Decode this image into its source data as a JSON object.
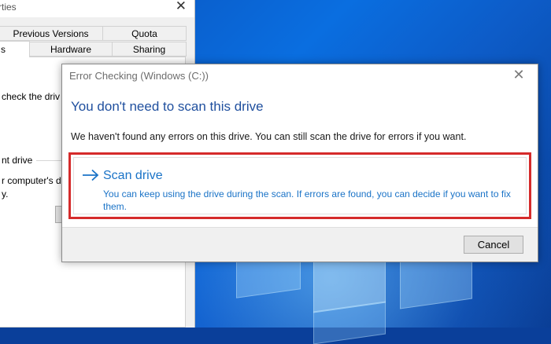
{
  "properties_window": {
    "title_fragment": "rties",
    "close_glyph": "✕",
    "tabs": [
      {
        "label": "Previous Versions"
      },
      {
        "label": "Quota"
      },
      {
        "label": "s"
      },
      {
        "label": "Hardware"
      },
      {
        "label": "Sharing"
      }
    ],
    "text_fragments": [
      "check the driv",
      "nt drive",
      "r computer's dr",
      "y."
    ]
  },
  "dialog": {
    "title": "Error Checking (Windows (C:))",
    "close_glyph": "✕",
    "heading": "You don't need to scan this drive",
    "message": "We haven't found any errors on this drive. You can still scan the drive for errors if you want.",
    "scan_option": {
      "label": "Scan drive",
      "description": "You can keep using the drive during the scan. If errors are found, you can decide if you want to fix them.",
      "icon": "arrow-right-icon",
      "highlight_color": "#d52b2b",
      "text_color": "#1a73c7"
    },
    "cancel_label": "Cancel"
  },
  "colors": {
    "heading": "#1f4f9e",
    "desktop": "#0a6ee0"
  }
}
